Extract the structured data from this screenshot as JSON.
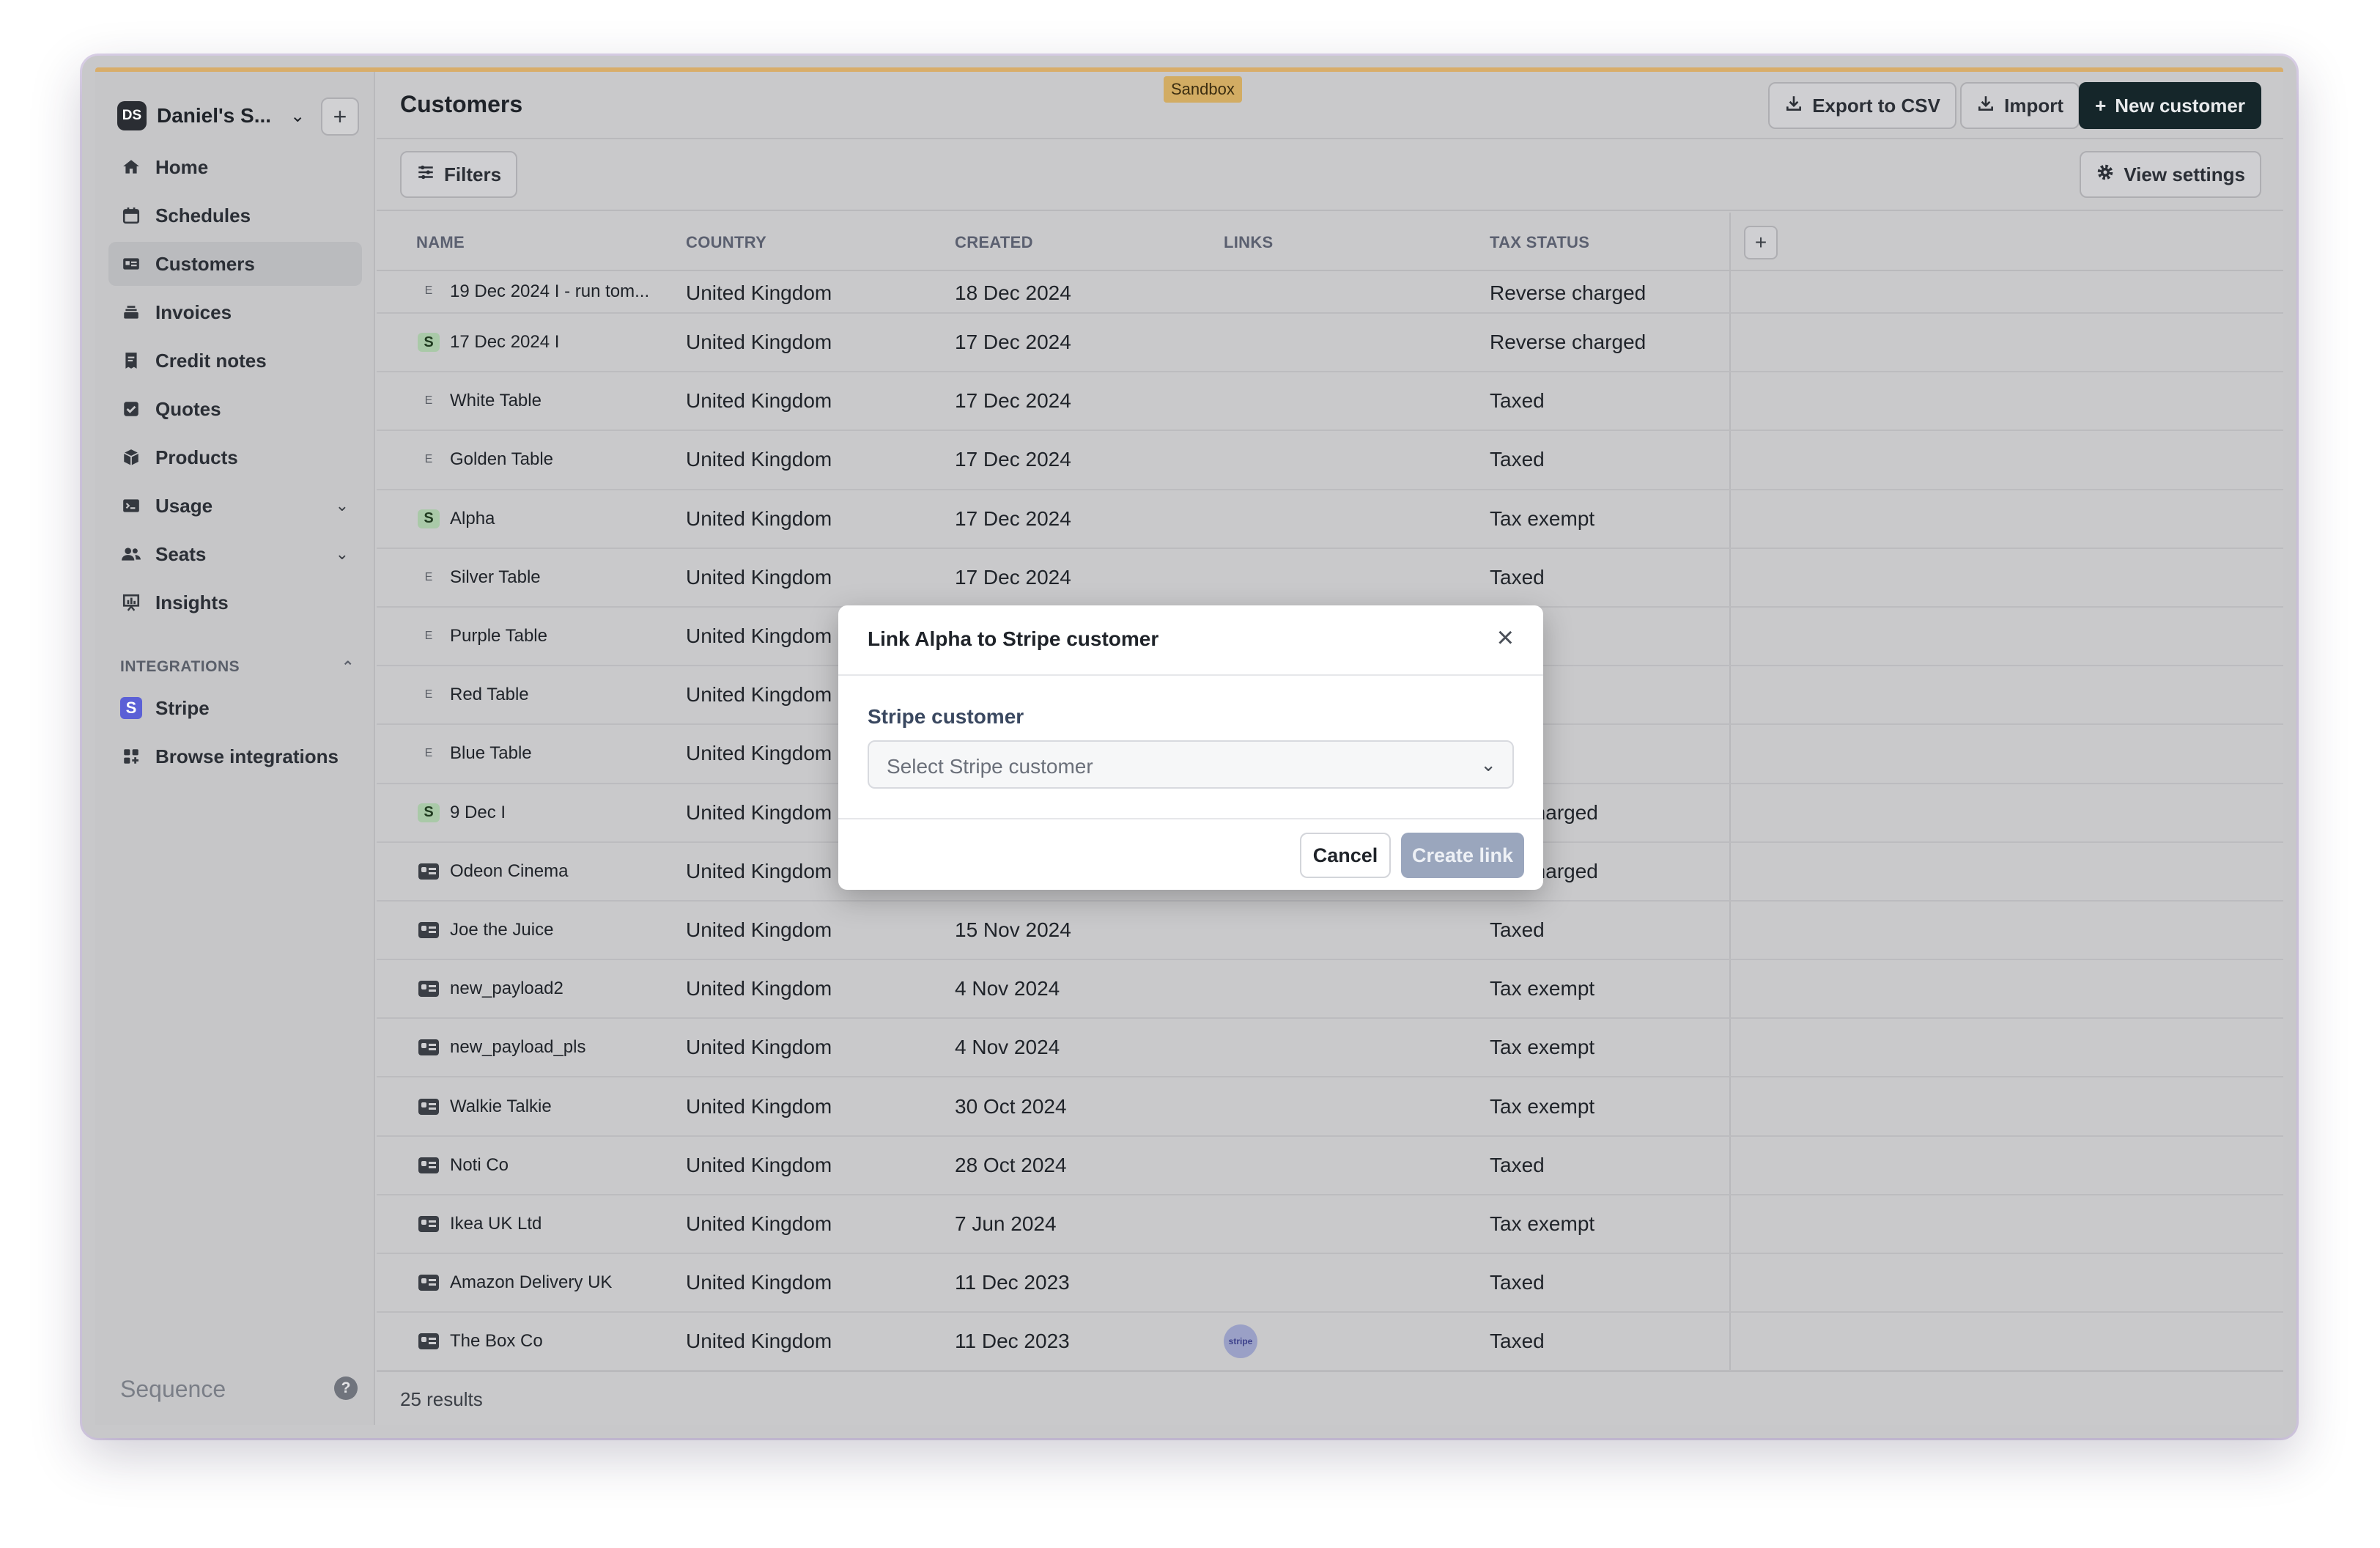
{
  "workspace": {
    "initials": "DS",
    "name": "Daniel's S..."
  },
  "sidebar": {
    "items": [
      {
        "label": "Home",
        "icon": "home-icon"
      },
      {
        "label": "Schedules",
        "icon": "calendar-icon"
      },
      {
        "label": "Customers",
        "icon": "id-card-icon",
        "active": true
      },
      {
        "label": "Invoices",
        "icon": "stack-icon"
      },
      {
        "label": "Credit notes",
        "icon": "credit-note-icon"
      },
      {
        "label": "Quotes",
        "icon": "check-square-icon"
      },
      {
        "label": "Products",
        "icon": "box-icon"
      },
      {
        "label": "Usage",
        "icon": "terminal-icon",
        "expandable": true
      },
      {
        "label": "Seats",
        "icon": "users-icon",
        "expandable": true
      },
      {
        "label": "Insights",
        "icon": "chart-icon"
      }
    ],
    "integrations_heading": "INTEGRATIONS",
    "integrations": [
      {
        "label": "Stripe",
        "icon": "stripe-icon"
      },
      {
        "label": "Browse integrations",
        "icon": "grid-plus-icon"
      }
    ],
    "brand": "Sequence"
  },
  "header": {
    "title": "Customers",
    "env_badge": "Sandbox",
    "export_label": "Export to CSV",
    "import_label": "Import",
    "new_label": "New customer"
  },
  "toolbar": {
    "filters_label": "Filters",
    "view_settings_label": "View settings"
  },
  "table": {
    "columns": [
      "NAME",
      "COUNTRY",
      "CREATED",
      "LINKS",
      "TAX STATUS"
    ],
    "rows": [
      {
        "icon": "E",
        "name": "19 Dec 2024 I - run tom...",
        "country": "United Kingdom",
        "created": "18 Dec 2024",
        "tax": "Reverse charged"
      },
      {
        "icon": "S",
        "name": "17 Dec 2024 I",
        "country": "United Kingdom",
        "created": "17 Dec 2024",
        "tax": "Reverse charged"
      },
      {
        "icon": "E",
        "name": "White Table",
        "country": "United Kingdom",
        "created": "17 Dec 2024",
        "tax": "Taxed"
      },
      {
        "icon": "E",
        "name": "Golden Table",
        "country": "United Kingdom",
        "created": "17 Dec 2024",
        "tax": "Taxed"
      },
      {
        "icon": "S",
        "name": "Alpha",
        "country": "United Kingdom",
        "created": "17 Dec 2024",
        "tax": "Tax exempt"
      },
      {
        "icon": "E",
        "name": "Silver Table",
        "country": "United Kingdom",
        "created": "17 Dec 2024",
        "tax": "Taxed"
      },
      {
        "icon": "E",
        "name": "Purple Table",
        "country": "United Kingdom",
        "created": "",
        "tax": ""
      },
      {
        "icon": "E",
        "name": "Red Table",
        "country": "United Kingdom",
        "created": "",
        "tax": ""
      },
      {
        "icon": "E",
        "name": "Blue Table",
        "country": "United Kingdom",
        "created": "",
        "tax": ""
      },
      {
        "icon": "S",
        "name": "9 Dec I",
        "country": "United Kingdom",
        "created": "",
        "tax": "rse charged"
      },
      {
        "icon": "card",
        "name": "Odeon Cinema",
        "country": "United Kingdom",
        "created": "",
        "tax": "rse charged"
      },
      {
        "icon": "card",
        "name": "Joe the Juice",
        "country": "United Kingdom",
        "created": "15 Nov 2024",
        "tax": "Taxed"
      },
      {
        "icon": "card",
        "name": "new_payload2",
        "country": "United Kingdom",
        "created": "4 Nov 2024",
        "tax": "Tax exempt"
      },
      {
        "icon": "card",
        "name": "new_payload_pls",
        "country": "United Kingdom",
        "created": "4 Nov 2024",
        "tax": "Tax exempt"
      },
      {
        "icon": "card",
        "name": "Walkie Talkie",
        "country": "United Kingdom",
        "created": "30 Oct 2024",
        "tax": "Tax exempt"
      },
      {
        "icon": "card",
        "name": "Noti Co",
        "country": "United Kingdom",
        "created": "28 Oct 2024",
        "tax": "Taxed"
      },
      {
        "icon": "card",
        "name": "Ikea UK Ltd",
        "country": "United Kingdom",
        "created": "7 Jun 2024",
        "tax": "Tax exempt"
      },
      {
        "icon": "card",
        "name": "Amazon Delivery UK",
        "country": "United Kingdom",
        "created": "11 Dec 2023",
        "tax": "Taxed"
      },
      {
        "icon": "card",
        "name": "The Box Co",
        "country": "United Kingdom",
        "created": "11 Dec 2023",
        "tax": "Taxed",
        "link": "stripe"
      }
    ],
    "results": "25 results"
  },
  "modal": {
    "title": "Link Alpha to Stripe customer",
    "field_label": "Stripe customer",
    "select_placeholder": "Select Stripe customer",
    "cancel_label": "Cancel",
    "create_label": "Create link"
  }
}
